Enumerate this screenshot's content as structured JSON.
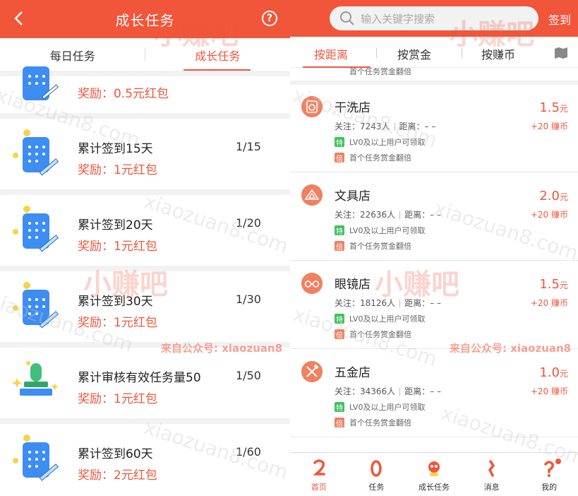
{
  "left": {
    "header": {
      "title": "成长任务"
    },
    "tabs": [
      {
        "label": "每日任务"
      },
      {
        "label": "成长任务"
      }
    ],
    "partial_reward": "奖励：0.5元红包",
    "tasks": [
      {
        "name": "累计签到15天",
        "reward": "奖励：1元红包",
        "progress": "1/15",
        "icon": "calendar-scroll-icon"
      },
      {
        "name": "累计签到20天",
        "reward": "奖励：1元红包",
        "progress": "1/20",
        "icon": "calendar-scroll-icon"
      },
      {
        "name": "累计签到30天",
        "reward": "奖励：1元红包",
        "progress": "1/30",
        "icon": "calendar-scroll-icon"
      },
      {
        "name": "累计审核有效任务量50",
        "reward": "奖励：1元红包",
        "progress": "1/50",
        "icon": "stamp-icon"
      },
      {
        "name": "累计签到60天",
        "reward": "奖励：2元红包",
        "progress": "1/60",
        "icon": "calendar-scroll-icon"
      }
    ]
  },
  "right": {
    "search": {
      "placeholder": "输入关键字搜索"
    },
    "checkin_label": "签到",
    "tabs": [
      {
        "label": "按距离"
      },
      {
        "label": "按赏金"
      },
      {
        "label": "按赚币"
      }
    ],
    "partial_text": "首个任务赏金翻倍",
    "shops": [
      {
        "name": "干洗店",
        "follow": "关注：7243人",
        "distance": "距离：– –",
        "tag1": "LV0及以上用户可领取",
        "tag2": "首个任务赏金翻倍",
        "price": "1.5",
        "unit": "元",
        "coin": "+20 赚币",
        "icon": "washing-machine-icon"
      },
      {
        "name": "文具店",
        "follow": "关注：22636人",
        "distance": "距离：– –",
        "tag1": "LV0及以上用户可领取",
        "tag2": "首个任务赏金翻倍",
        "price": "2.0",
        "unit": "元",
        "coin": "+20 赚币",
        "icon": "triangle-ruler-icon"
      },
      {
        "name": "眼镜店",
        "follow": "关注：18126人",
        "distance": "距离：– –",
        "tag1": "LV0及以上用户可领取",
        "tag2": "首个任务赏金翻倍",
        "price": "1.5",
        "unit": "元",
        "coin": "+20 赚币",
        "icon": "glasses-icon"
      },
      {
        "name": "五金店",
        "follow": "关注：34366人",
        "distance": "距离：– –",
        "tag1": "LV0及以上用户可领取",
        "tag2": "首个任务赏金翻倍",
        "price": "1.0",
        "unit": "元",
        "coin": "+20 赚币",
        "icon": "tools-icon"
      }
    ],
    "tag_badges": {
      "special": "特",
      "double": "倍"
    },
    "bottom_nav": [
      {
        "label": "首页",
        "icon": "home-icon"
      },
      {
        "label": "任务",
        "icon": "task-icon"
      },
      {
        "label": "成长任务",
        "icon": "growth-icon"
      },
      {
        "label": "消息",
        "icon": "message-icon"
      },
      {
        "label": "我的",
        "icon": "profile-icon"
      }
    ]
  },
  "watermark": {
    "site": "xiaozuan8.com",
    "brand": "小赚吧",
    "source": "来自公众号: xiaozuan8"
  },
  "colors": {
    "accent": "#f1553a",
    "green_badge": "#3ec25a",
    "orange_badge": "#f08060"
  }
}
